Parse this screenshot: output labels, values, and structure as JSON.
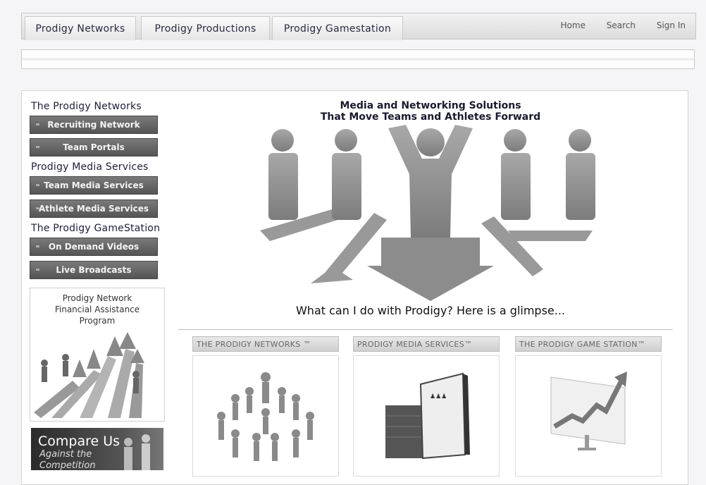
{
  "tabs": [
    {
      "label": "Prodigy Networks"
    },
    {
      "label": "Prodigy Productions"
    },
    {
      "label": "Prodigy Gamestation"
    }
  ],
  "top_links": [
    "Home",
    "Search",
    "Sign In"
  ],
  "sidebar": {
    "sections": [
      {
        "heading": "The Prodigy Networks",
        "items": [
          "Recruiting Network",
          "Team Portals"
        ]
      },
      {
        "heading": "Prodigy Media Services",
        "items": [
          "Team Media Services",
          "Athlete Media Services"
        ]
      },
      {
        "heading": "The Prodigy GameStation",
        "items": [
          "On Demand Videos",
          "Live Broadcasts"
        ]
      }
    ],
    "promo_financial": [
      "Prodigy Network",
      "Financial Assistance",
      "Program"
    ],
    "promo_compare": {
      "line1": "Compare Us",
      "line2": "Against the",
      "line3": "Competition"
    }
  },
  "hero": {
    "headline_line1": "Media and Networking Solutions",
    "headline_line2": "That Move Teams and Athletes Forward",
    "tagline": "What can I do with Prodigy?  Here is a glimpse..."
  },
  "cards": [
    {
      "title": "THE PRODIGY NETWORKS ™"
    },
    {
      "title": "PRODIGY MEDIA SERVICES™"
    },
    {
      "title": "THE PRODIGY GAME STATION™"
    }
  ],
  "colors": {
    "nav_button": "#666666",
    "accent_text": "#1a1a2e",
    "figure_gray": "#8f8f8f"
  }
}
